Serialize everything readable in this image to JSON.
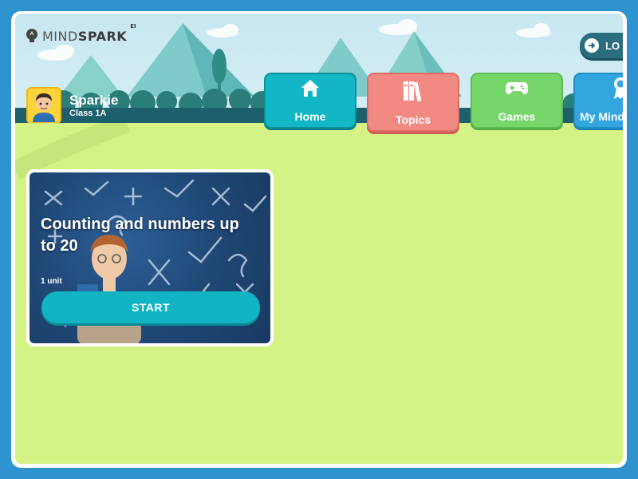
{
  "brand": {
    "name_light": "MIND",
    "name_bold": "SPARK",
    "superscript": "EI"
  },
  "header": {
    "logout_label": "LO"
  },
  "user": {
    "name": "Sparkie",
    "class": "Class 1A"
  },
  "tabs": [
    {
      "label": "Home",
      "icon": "home-icon",
      "color": "#12b6c4"
    },
    {
      "label": "Topics",
      "icon": "books-icon",
      "color": "#f18a82"
    },
    {
      "label": "Games",
      "icon": "gamepad-icon",
      "color": "#77d66a"
    },
    {
      "label": "My Mind",
      "icon": "ribbon-badge-icon",
      "color": "#33a6df"
    }
  ],
  "topic_card": {
    "title": "Counting and numbers up to 20",
    "units": "1 unit",
    "start_label": "START"
  },
  "colors": {
    "background": "#2f93cf",
    "stage": "#d4f285",
    "accent": "#12b4c3"
  }
}
